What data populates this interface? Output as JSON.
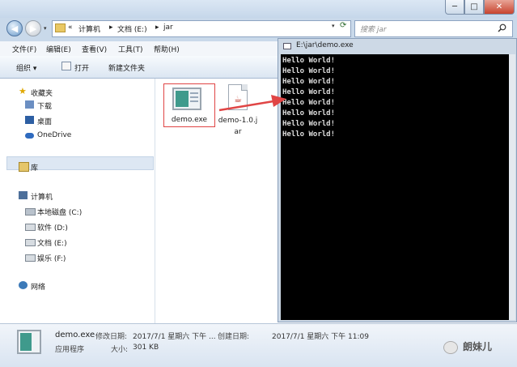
{
  "window": {
    "controls": {
      "minimize": "─",
      "maximize": "□",
      "close": "✕"
    }
  },
  "navigation": {
    "back_glyph": "◀",
    "forward_glyph": "▶",
    "history_glyph": "▾",
    "breadcrumbs": [
      "«",
      "计算机",
      "▸",
      "文档 (E:)",
      "▸",
      "jar"
    ],
    "refresh_glyph": "⟳",
    "dropdown_glyph": "▾"
  },
  "search": {
    "placeholder": "搜索 jar",
    "icon": "search-icon"
  },
  "menu": [
    "文件(F)",
    "编辑(E)",
    "查看(V)",
    "工具(T)",
    "帮助(H)"
  ],
  "toolbar": {
    "organize": "组织 ▾",
    "open": "打开",
    "new_folder": "新建文件夹"
  },
  "sidebar": {
    "items": [
      {
        "label": "收藏夹",
        "icon": "star-icon"
      },
      {
        "label": "下载",
        "icon": "downloads-icon"
      },
      {
        "label": "桌面",
        "icon": "desktop-icon"
      },
      {
        "label": "OneDrive",
        "icon": "cloud-icon"
      },
      {
        "label": "库",
        "icon": "library-icon"
      },
      {
        "label": "计算机",
        "icon": "computer-icon"
      },
      {
        "label": "本地磁盘 (C:)",
        "icon": "drive-icon"
      },
      {
        "label": "软件 (D:)",
        "icon": "drive-icon"
      },
      {
        "label": "文档 (E:)",
        "icon": "drive-icon"
      },
      {
        "label": "娱乐 (F:)",
        "icon": "drive-icon"
      },
      {
        "label": "网络",
        "icon": "network-icon"
      }
    ],
    "selected": "文档 (E:)"
  },
  "files": [
    {
      "name": "demo.exe",
      "icon": "exe-icon",
      "highlighted": true
    },
    {
      "name_line1": "demo-1.0.j",
      "name_line2": "ar",
      "icon": "jar-icon"
    }
  ],
  "console": {
    "title": "E:\\jar\\demo.exe",
    "output": "Hello World!\nHello World!\nHello World!\nHello World!\nHello World!\nHello World!\nHello World!\nHello World!"
  },
  "details": {
    "name": "demo.exe",
    "type": "应用程序",
    "modified_label": "修改日期:",
    "modified": "2017/7/1 星期六 下午 ...",
    "created_label": "创建日期:",
    "created": "2017/7/1 星期六 下午 11:09",
    "size_label": "大小:",
    "size": "301 KB"
  },
  "watermark": {
    "text": "朗妹儿"
  },
  "colors": {
    "accent": "#e04545",
    "console_bg": "#000000",
    "frame": "#c9d9ea"
  }
}
